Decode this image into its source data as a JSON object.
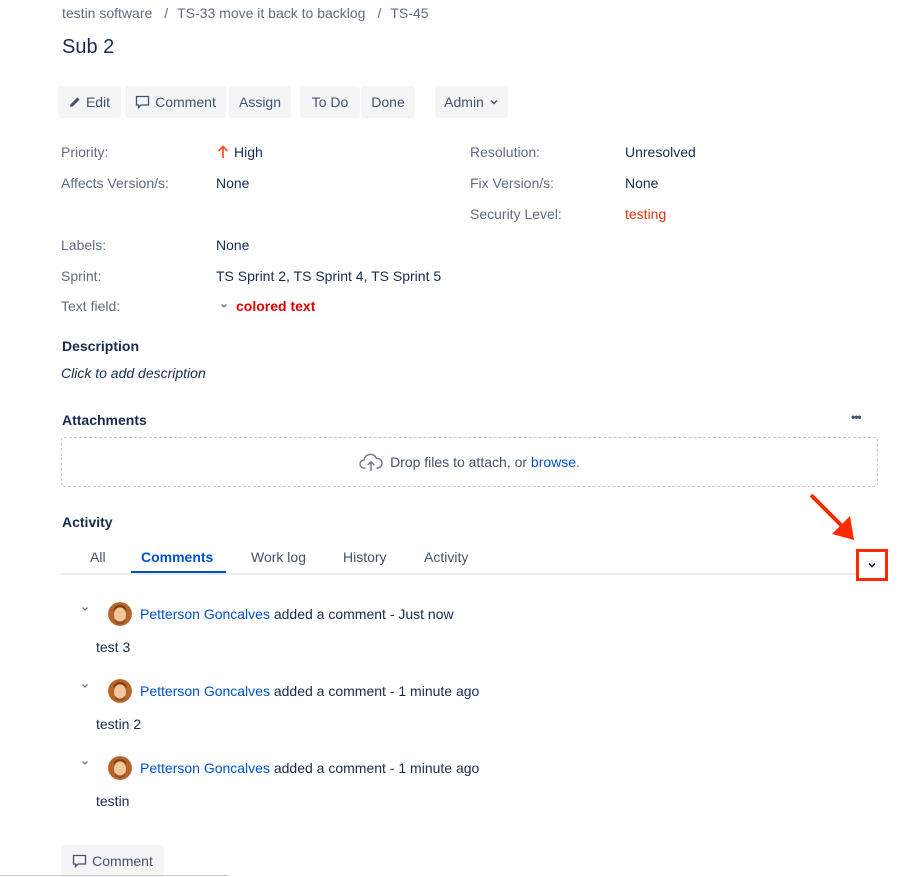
{
  "breadcrumb": {
    "project": "testin software",
    "parent": "TS-33 move it back to backlog",
    "issue": "TS-45",
    "separator": "/"
  },
  "title": "Sub 2",
  "toolbar": {
    "edit": "Edit",
    "comment": "Comment",
    "assign": "Assign",
    "todo": "To Do",
    "done": "Done",
    "admin": "Admin"
  },
  "details": {
    "priority_label": "Priority:",
    "priority_value": "High",
    "affects_label": "Affects Version/s:",
    "affects_value": "None",
    "labels_label": "Labels:",
    "labels_value": "None",
    "sprint_label": "Sprint:",
    "sprint_value": "TS Sprint 2, TS Sprint 4, TS Sprint 5",
    "textfield_label": "Text field:",
    "textfield_value": "colored text",
    "resolution_label": "Resolution:",
    "resolution_value": "Unresolved",
    "fixversion_label": "Fix Version/s:",
    "fixversion_value": "None",
    "security_label": "Security Level:",
    "security_value": "testing"
  },
  "description": {
    "title": "Description",
    "placeholder": "Click to add description"
  },
  "attachments": {
    "title": "Attachments",
    "more": "•••",
    "drop_text": "Drop files to attach, or ",
    "browse": "browse",
    "period": "."
  },
  "activity": {
    "title": "Activity",
    "tabs": [
      "All",
      "Comments",
      "Work log",
      "History",
      "Activity"
    ],
    "active_tab": "Comments"
  },
  "comments": [
    {
      "author": "Petterson Goncalves",
      "action": " added a comment - Just now",
      "body": "test 3"
    },
    {
      "author": "Petterson Goncalves",
      "action": " added a comment - 1 minute ago",
      "body": "testin 2"
    },
    {
      "author": "Petterson Goncalves",
      "action": " added a comment - 1 minute ago",
      "body": "testin"
    }
  ],
  "footer": {
    "comment_button": "Comment"
  },
  "colors": {
    "link": "#0052cc",
    "text": "#172b4d",
    "muted": "#5e6c84",
    "priority_high": "#ff5630",
    "colored_text": "#e00000",
    "security": "#de350b",
    "annotation": "#ff2a00"
  },
  "icons": {
    "edit": "pencil-icon",
    "comment": "speech-bubble-icon",
    "admin_caret": "chevron-down-icon",
    "priority": "arrow-up-icon",
    "upload": "cloud-upload-icon",
    "more": "more-dots-icon",
    "comment_toggle": "chevron-down-icon",
    "sort": "chevron-down-icon"
  }
}
